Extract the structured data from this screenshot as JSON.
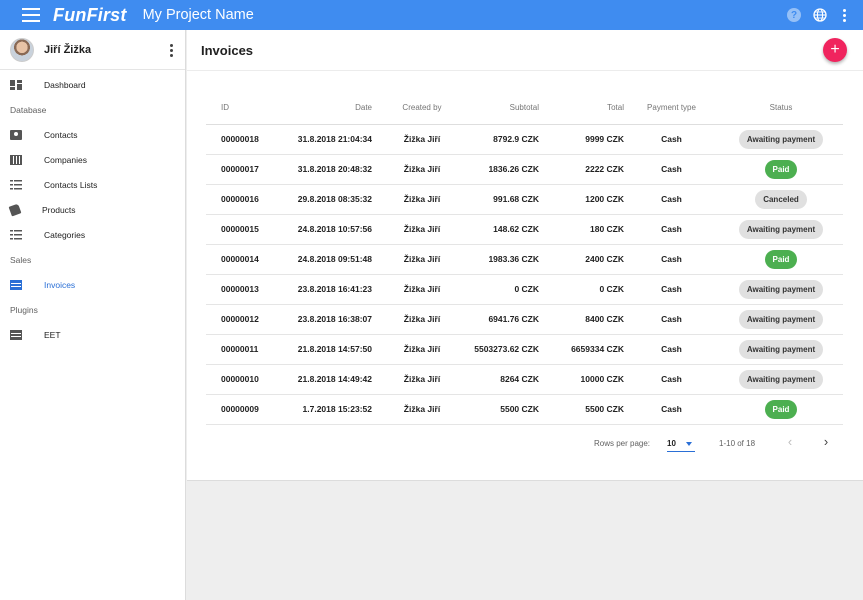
{
  "appbar": {
    "logo": "FunFirst",
    "project": "My Project Name"
  },
  "user": {
    "name": "Jiří Žižka"
  },
  "sidebar": {
    "items": [
      {
        "label": "Dashboard",
        "icon": "dashboard-icon"
      },
      {
        "section": "Database"
      },
      {
        "label": "Contacts",
        "icon": "contacts-icon"
      },
      {
        "label": "Companies",
        "icon": "companies-icon"
      },
      {
        "label": "Contacts Lists",
        "icon": "list-icon"
      },
      {
        "label": "Products",
        "icon": "tag-icon"
      },
      {
        "label": "Categories",
        "icon": "list-icon"
      },
      {
        "section": "Sales"
      },
      {
        "label": "Invoices",
        "icon": "invoice-icon",
        "active": true
      },
      {
        "section": "Plugins"
      },
      {
        "label": "EET",
        "icon": "receipt-icon"
      }
    ]
  },
  "main": {
    "title": "Invoices",
    "fab": "+",
    "columns": [
      "ID",
      "Date",
      "Created by",
      "Subtotal",
      "Total",
      "Payment type",
      "Status"
    ],
    "rows": [
      {
        "id": "00000018",
        "date": "31.8.2018 21:04:34",
        "by": "Žižka Jiří",
        "subtotal": "8792.9 CZK",
        "total": "9999 CZK",
        "payment": "Cash",
        "status": "Awaiting payment"
      },
      {
        "id": "00000017",
        "date": "31.8.2018 20:48:32",
        "by": "Žižka Jiří",
        "subtotal": "1836.26 CZK",
        "total": "2222 CZK",
        "payment": "Cash",
        "status": "Paid"
      },
      {
        "id": "00000016",
        "date": "29.8.2018 08:35:32",
        "by": "Žižka Jiří",
        "subtotal": "991.68 CZK",
        "total": "1200 CZK",
        "payment": "Cash",
        "status": "Canceled"
      },
      {
        "id": "00000015",
        "date": "24.8.2018 10:57:56",
        "by": "Žižka Jiří",
        "subtotal": "148.62 CZK",
        "total": "180 CZK",
        "payment": "Cash",
        "status": "Awaiting payment"
      },
      {
        "id": "00000014",
        "date": "24.8.2018 09:51:48",
        "by": "Žižka Jiří",
        "subtotal": "1983.36 CZK",
        "total": "2400 CZK",
        "payment": "Cash",
        "status": "Paid"
      },
      {
        "id": "00000013",
        "date": "23.8.2018 16:41:23",
        "by": "Žižka Jiří",
        "subtotal": "0 CZK",
        "total": "0 CZK",
        "payment": "Cash",
        "status": "Awaiting payment"
      },
      {
        "id": "00000012",
        "date": "23.8.2018 16:38:07",
        "by": "Žižka Jiří",
        "subtotal": "6941.76 CZK",
        "total": "8400 CZK",
        "payment": "Cash",
        "status": "Awaiting payment"
      },
      {
        "id": "00000011",
        "date": "21.8.2018 14:57:50",
        "by": "Žižka Jiří",
        "subtotal": "5503273.62 CZK",
        "total": "6659334 CZK",
        "payment": "Cash",
        "status": "Awaiting payment"
      },
      {
        "id": "00000010",
        "date": "21.8.2018 14:49:42",
        "by": "Žižka Jiří",
        "subtotal": "8264 CZK",
        "total": "10000 CZK",
        "payment": "Cash",
        "status": "Awaiting payment"
      },
      {
        "id": "00000009",
        "date": "1.7.2018 15:23:52",
        "by": "Žižka Jiří",
        "subtotal": "5500 CZK",
        "total": "5500 CZK",
        "payment": "Cash",
        "status": "Paid"
      }
    ],
    "pagination": {
      "rows_per_page_label": "Rows per page:",
      "rows_per_page": "10",
      "range": "1-10 of 18",
      "prev": "‹",
      "next": "›"
    }
  },
  "colors": {
    "appbar": "#3f8cf0",
    "fab": "#f0245e",
    "paid": "#4caf50",
    "active_nav": "#2a6fd6"
  }
}
